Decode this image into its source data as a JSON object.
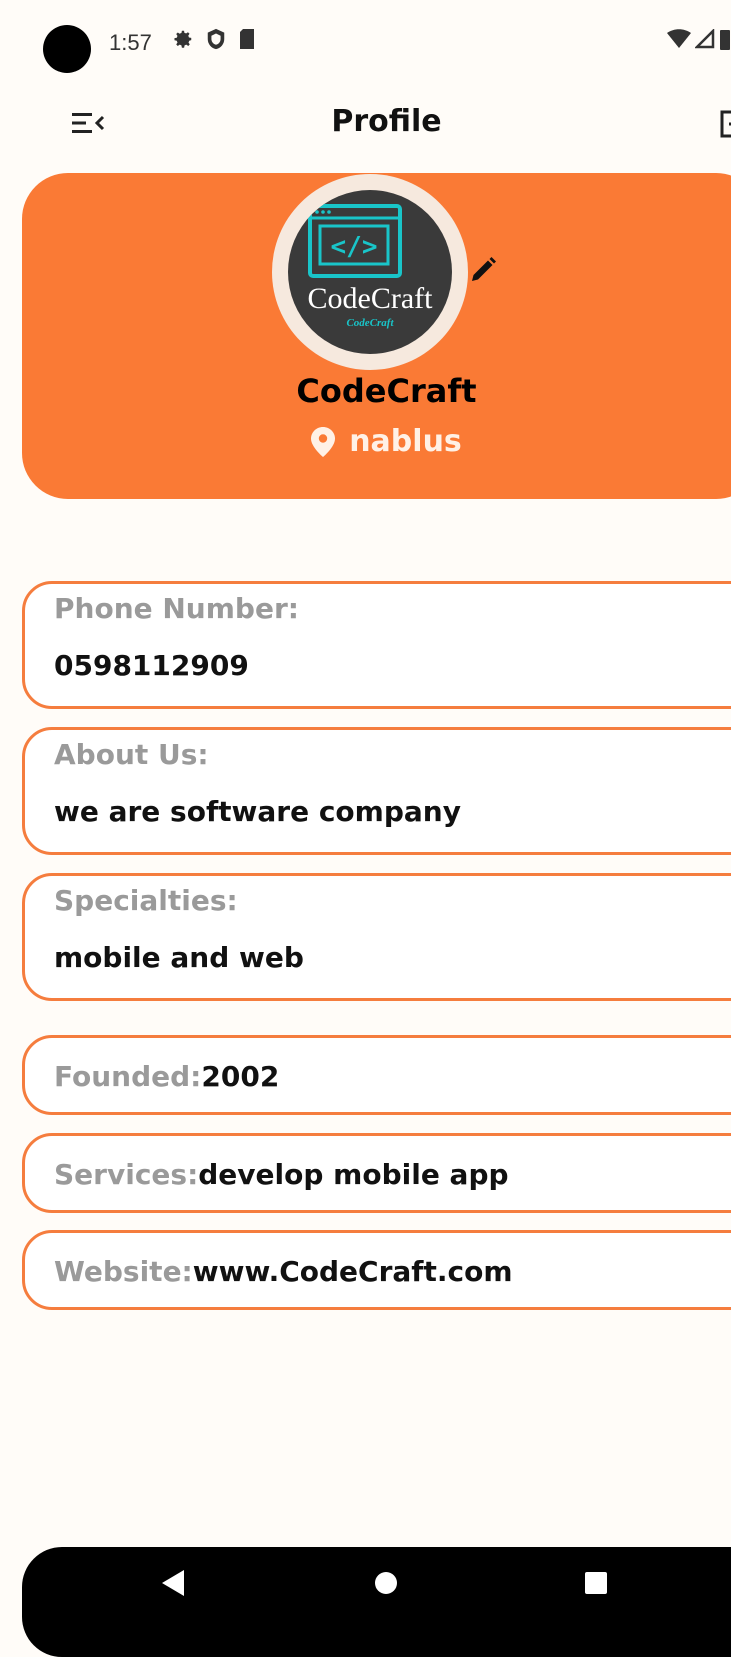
{
  "status_bar": {
    "time": "1:57",
    "icons": [
      "settings-icon",
      "shield-icon",
      "sd-card-icon"
    ],
    "right_icons": [
      "wifi-icon",
      "signal-icon",
      "battery-icon"
    ]
  },
  "app_bar": {
    "title": "Profile",
    "menu_icon": "menu-open-icon",
    "logout_icon": "logout-icon"
  },
  "header": {
    "company_name": "CodeCraft",
    "location": "nablus",
    "logo": {
      "text_main": "CodeCraft",
      "text_small": "CodeCraft",
      "code_symbol": "</>"
    },
    "colors": {
      "card": "#FA7A35",
      "logo_accent": "#19C5C9"
    }
  },
  "info": {
    "phone": {
      "label": "Phone Number:",
      "value": "0598112909"
    },
    "about": {
      "label": "About Us:",
      "value": "we are software company"
    },
    "specialties": {
      "label": "Specialties:",
      "value": "mobile and web"
    },
    "founded": {
      "label": "Founded:",
      "value": "2002"
    },
    "services": {
      "label": "Services:",
      "value": "develop mobile app"
    },
    "website": {
      "label": "Website:",
      "value": "www.CodeCraft.com"
    }
  },
  "nav_bar": {
    "buttons": [
      "back-icon",
      "home-icon",
      "recents-icon"
    ]
  }
}
